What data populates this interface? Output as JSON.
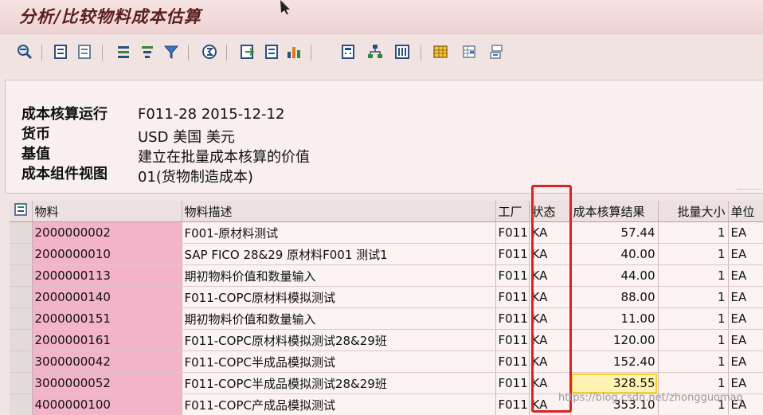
{
  "window": {
    "title": "分析/比较物料成本估算"
  },
  "toolbar": {
    "icons": [
      "details-icon",
      "move-left-icon",
      "move-right-icon",
      "sort-ascending-icon",
      "sort-descending-icon",
      "filter-icon",
      "sum-icon",
      "export-icon",
      "print-icon",
      "chart-icon",
      "calculator-icon",
      "hierarchy-icon",
      "columns-icon",
      "table-view-icon",
      "table-insert-icon",
      "table-layout-icon"
    ]
  },
  "header": {
    "fields": [
      {
        "label": "成本核算运行",
        "value": "F011-28 2015-12-12"
      },
      {
        "label": "货币",
        "value": "USD 美国 美元"
      },
      {
        "label": "基值",
        "value": "建立在批量成本核算的价值"
      },
      {
        "label": "成本组件视图",
        "value": "01(货物制造成本)"
      }
    ]
  },
  "table": {
    "columns": [
      "物料",
      "物料描述",
      "工厂",
      "状态",
      "成本核算结果",
      "批量大小",
      "单位"
    ],
    "rows": [
      {
        "material": "2000000002",
        "description": "F001-原材料测试",
        "plant": "F011",
        "status": "KA",
        "result": "57.44",
        "lot": "1",
        "unit": "EA"
      },
      {
        "material": "2000000010",
        "description": "SAP FICO 28&29 原材料F001 测试1",
        "plant": "F011",
        "status": "KA",
        "result": "40.00",
        "lot": "1",
        "unit": "EA"
      },
      {
        "material": "2000000113",
        "description": "期初物料价值和数量输入",
        "plant": "F011",
        "status": "KA",
        "result": "44.00",
        "lot": "1",
        "unit": "EA"
      },
      {
        "material": "2000000140",
        "description": "F011-COPC原材料模拟测试",
        "plant": "F011",
        "status": "KA",
        "result": "88.00",
        "lot": "1",
        "unit": "EA"
      },
      {
        "material": "2000000151",
        "description": "期初物料价值和数量输入",
        "plant": "F011",
        "status": "KA",
        "result": "11.00",
        "lot": "1",
        "unit": "EA"
      },
      {
        "material": "2000000161",
        "description": "F011-COPC原材料模拟测试28&29班",
        "plant": "F011",
        "status": "KA",
        "result": "120.00",
        "lot": "1",
        "unit": "EA"
      },
      {
        "material": "3000000042",
        "description": "F011-COPC半成品模拟测试",
        "plant": "F011",
        "status": "KA",
        "result": "152.40",
        "lot": "1",
        "unit": "EA"
      },
      {
        "material": "3000000052",
        "description": "F011-COPC半成品模拟测试28&29班",
        "plant": "F011",
        "status": "KA",
        "result": "328.55",
        "lot": "1",
        "unit": "EA"
      },
      {
        "material": "4000000100",
        "description": "F011-COPC产成品模拟测试",
        "plant": "F011",
        "status": "KA",
        "result": "353.10",
        "lot": "1",
        "unit": "EA"
      }
    ]
  },
  "watermark": "https://blog.csdn.net/zhongguomao",
  "colors": {
    "material_highlight": "#f3b4c9",
    "status_box": "#e02020",
    "cell_highlight": "#fff3b3"
  }
}
